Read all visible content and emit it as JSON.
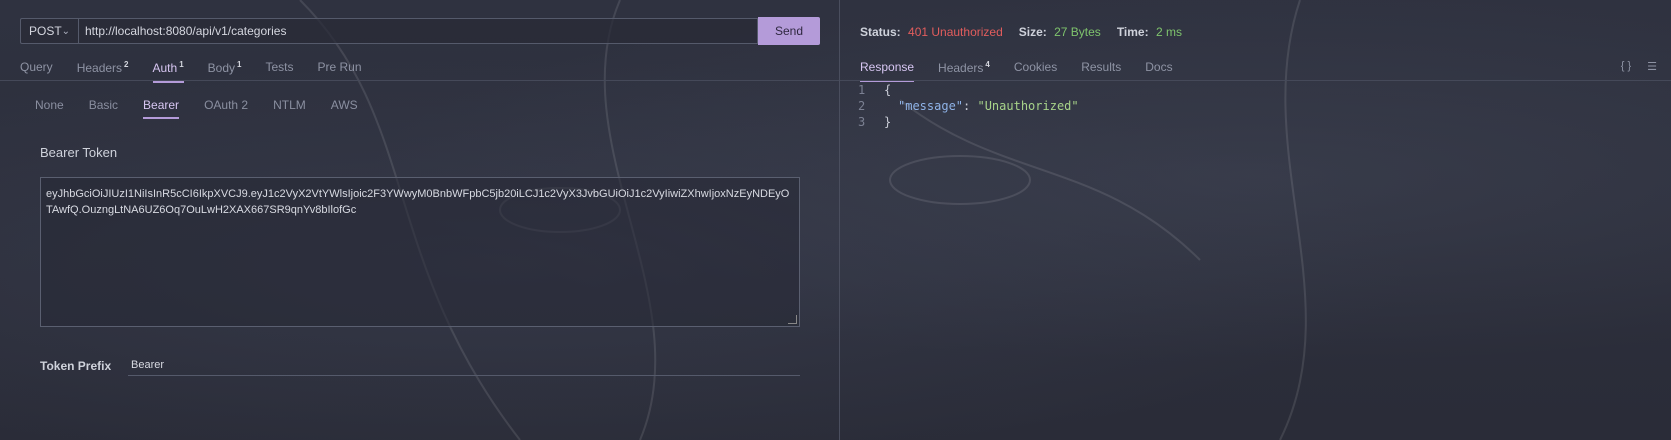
{
  "request": {
    "method": "POST",
    "url": "http://localhost:8080/api/v1/categories",
    "send_label": "Send"
  },
  "request_tabs": [
    {
      "label": "Query",
      "badge": ""
    },
    {
      "label": "Headers",
      "badge": "2"
    },
    {
      "label": "Auth",
      "badge": "1"
    },
    {
      "label": "Body",
      "badge": "1"
    },
    {
      "label": "Tests",
      "badge": ""
    },
    {
      "label": "Pre Run",
      "badge": ""
    }
  ],
  "auth_tabs": [
    "None",
    "Basic",
    "Bearer",
    "OAuth 2",
    "NTLM",
    "AWS"
  ],
  "bearer": {
    "title": "Bearer Token",
    "token": "eyJhbGciOiJIUzI1NiIsInR5cCI6IkpXVCJ9.eyJ1c2VyX2VtYWlsIjoic2F3YWwyM0BnbWFpbC5jb20iLCJ1c2VyX3JvbGUiOiJ1c2VyIiwiZXhwIjoxNzEyNDEyOTAwfQ.OuzngLtNA6UZ6Oq7OuLwH2XAX667SR9qnYv8bIlofGc",
    "prefix_label": "Token Prefix",
    "prefix_value": "Bearer"
  },
  "response": {
    "status_label": "Status:",
    "status_value": "401 Unauthorized",
    "size_label": "Size:",
    "size_value": "27 Bytes",
    "time_label": "Time:",
    "time_value": "2 ms",
    "tabs": [
      {
        "label": "Response",
        "badge": ""
      },
      {
        "label": "Headers",
        "badge": "4"
      },
      {
        "label": "Cookies",
        "badge": ""
      },
      {
        "label": "Results",
        "badge": ""
      },
      {
        "label": "Docs",
        "badge": ""
      }
    ],
    "icons": [
      "braces-icon",
      "menu-icon"
    ],
    "body_lines": [
      {
        "num": "1",
        "text": "{"
      },
      {
        "num": "2",
        "key": "\"message\"",
        "sep": ": ",
        "value": "\"Unauthorized\""
      },
      {
        "num": "3",
        "text": "}"
      }
    ]
  },
  "colors": {
    "accent": "#b49bd9",
    "status_error": "#e25d5d",
    "status_ok": "#7fc46d"
  }
}
